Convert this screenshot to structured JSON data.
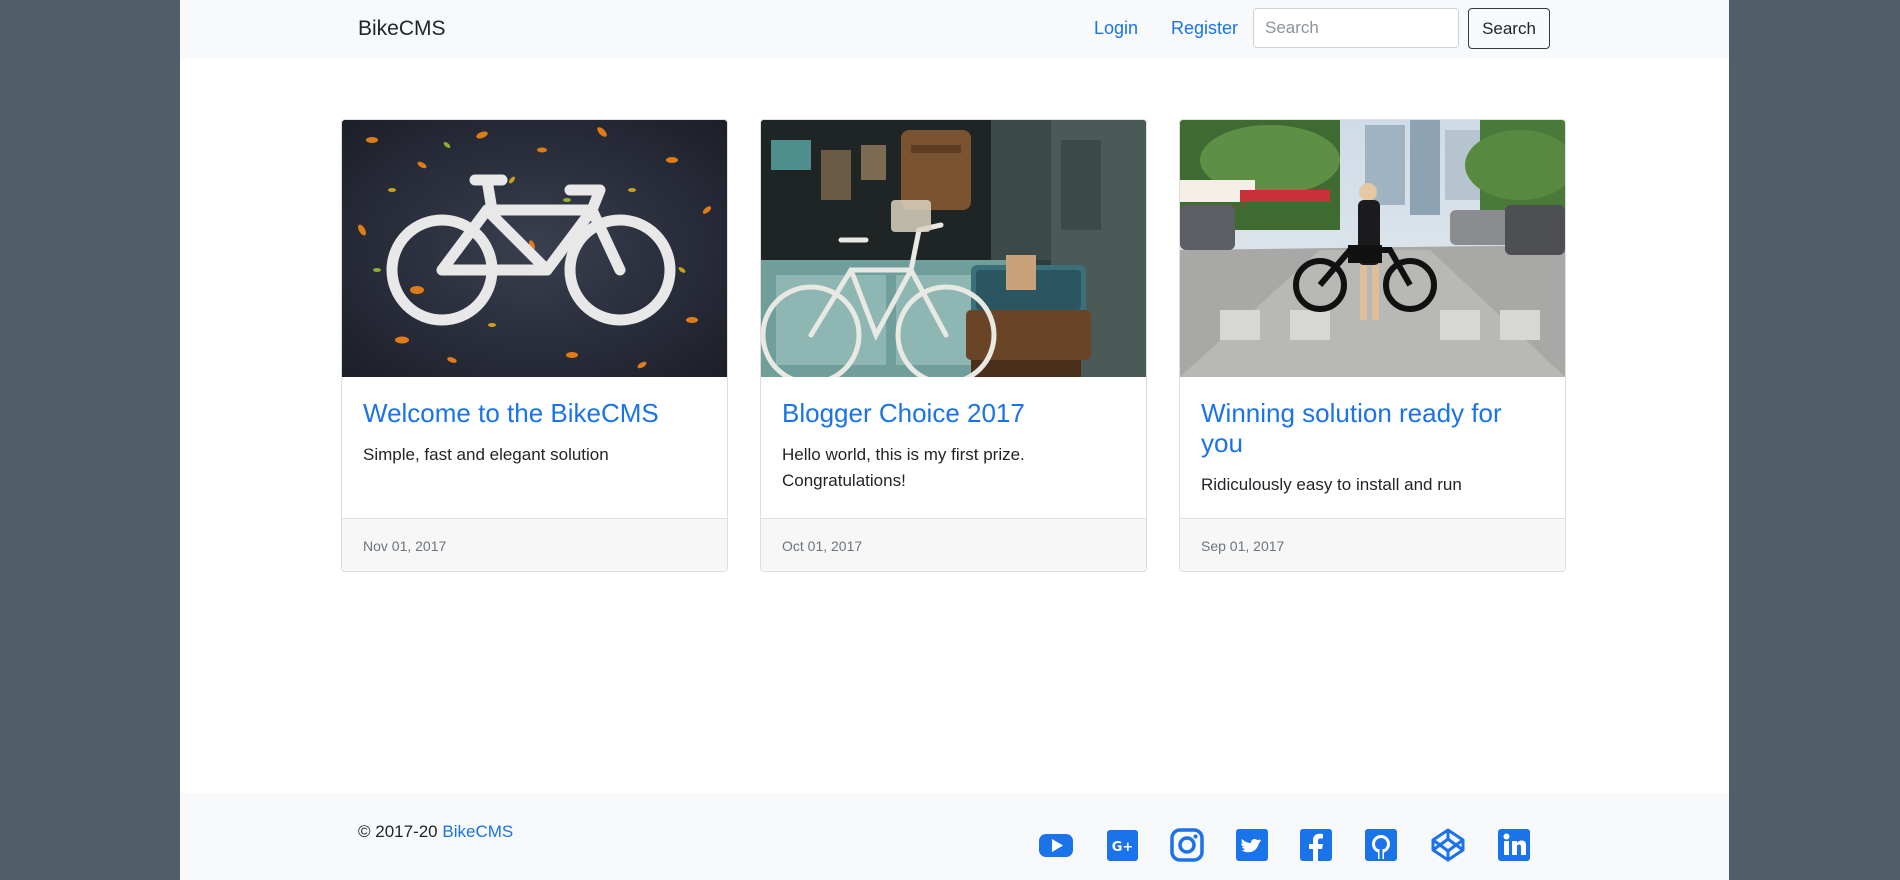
{
  "navbar": {
    "brand": "BikeCMS",
    "login_label": "Login",
    "register_label": "Register",
    "search_placeholder": "Search",
    "search_button_label": "Search"
  },
  "cards": [
    {
      "title": "Welcome to the BikeCMS",
      "text": "Simple, fast and elegant solution",
      "date": "Nov 01, 2017",
      "image": "bicycle-road-marking-photo"
    },
    {
      "title": "Blogger Choice 2017",
      "text": "Hello world, this is my first prize. Congratulations!",
      "date": "Oct 01, 2017",
      "image": "vintage-bicycle-suitcase-photo"
    },
    {
      "title": "Winning solution ready for you",
      "text": "Ridiculously easy to install and run",
      "date": "Sep 01, 2017",
      "image": "woman-ebike-street-photo"
    }
  ],
  "footer": {
    "copyright_prefix": "© 2017-20",
    "copyright_link": "BikeCMS",
    "social_icons": [
      "youtube-icon",
      "google-plus-icon",
      "instagram-icon",
      "twitter-icon",
      "facebook-icon",
      "github-icon",
      "codepen-icon",
      "linkedin-icon"
    ]
  },
  "colors": {
    "accent": "#1a73e8",
    "backdrop": "#515d69",
    "navbar_bg": "#f8f9fa",
    "card_footer_bg": "#f7f7f7"
  }
}
